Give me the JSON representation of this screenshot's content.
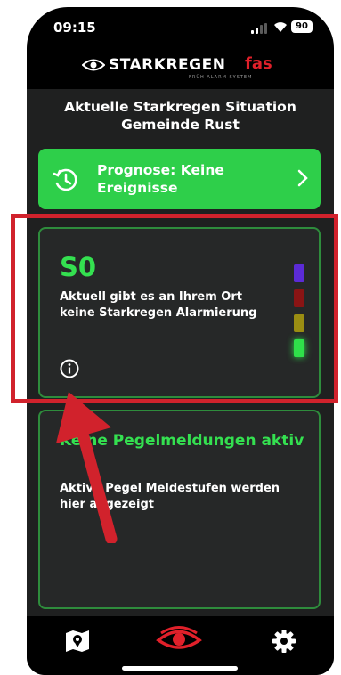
{
  "status_bar": {
    "time": "09:15",
    "battery": "90"
  },
  "brand": {
    "name": "STARKREGEN",
    "suffix": "fas",
    "tagline": "FRÜH·ALARM·SYSTEM"
  },
  "header": {
    "title": "Aktuelle Starkregen Situation Gemeinde Rust"
  },
  "prognose": {
    "label": "Prognose: Keine Ereignisse",
    "icon": "clock-icon"
  },
  "alarm_card": {
    "level": "S0",
    "message": "Aktuell gibt es an Ihrem Ort keine Starkregen Alarmierung",
    "info_icon": "info-icon",
    "scale_colors": [
      "#5b2bd6",
      "#8a1414",
      "#9a8d12",
      "#2fe04a"
    ],
    "active_level": "green"
  },
  "pegel_card": {
    "title": "Keine Pegelmeldungen aktiv",
    "subtitle": "Aktive Pegel Meldestufen werden hier angezeigt"
  },
  "nav": {
    "items": [
      "map-icon",
      "eye-icon",
      "gear-icon"
    ],
    "active": "eye-icon"
  },
  "colors": {
    "accent_green": "#34e050",
    "button_green": "#2ecf4a",
    "highlight_red": "#d1222c"
  }
}
